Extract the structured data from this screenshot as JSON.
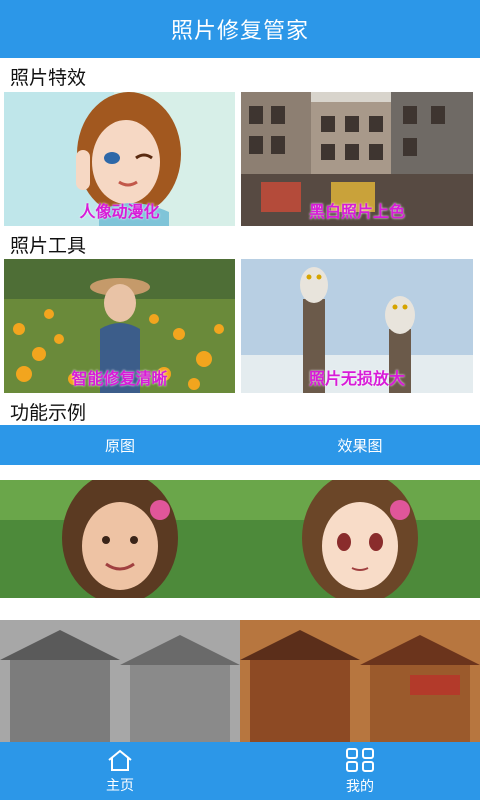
{
  "app": {
    "title": "照片修复管家"
  },
  "sections": {
    "effects": {
      "title": "照片特效",
      "cards": [
        {
          "caption": "人像动漫化"
        },
        {
          "caption": "黑白照片上色"
        }
      ]
    },
    "tools": {
      "title": "照片工具",
      "cards": [
        {
          "caption": "智能修复清晰"
        },
        {
          "caption": "照片无损放大"
        }
      ]
    },
    "examples": {
      "title": "功能示例",
      "tabs": {
        "left": "原图",
        "right": "效果图"
      }
    }
  },
  "bottom_nav": {
    "home": "主页",
    "mine": "我的"
  },
  "colors": {
    "primary": "#2c97e8",
    "caption": "#d81bd8"
  }
}
